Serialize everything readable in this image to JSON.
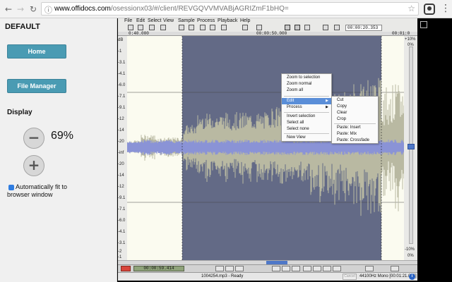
{
  "browser": {
    "url_host": "www.offidocs.com",
    "url_path": "/osession",
    "url_query": "x03/#/client/REVGQVVMVABjAGRIZmF1bHQ="
  },
  "left_panel": {
    "title": "DEFAULT",
    "home_label": "Home",
    "file_manager_label": "File Manager",
    "display_label": "Display",
    "zoom_minus": "−",
    "zoom_plus": "+",
    "zoom_value": "69%",
    "autofit_checked": true,
    "autofit_label": "Automatically fit to browser window"
  },
  "app": {
    "menu": [
      "File",
      "Edit",
      "Select",
      "View",
      "Sample",
      "Process",
      "Playback",
      "Help"
    ],
    "time_display": "00:00:20.353",
    "ruler_labels": [
      "0:40.000",
      "00:00:50.000",
      "00:01:0"
    ],
    "db_labels": [
      "dB",
      "-1",
      "-3.1",
      "-4.1",
      "-6.0",
      "-7.1",
      "-9.1",
      "-12",
      "-14",
      "-20",
      "-inf",
      "-20",
      "-14",
      "-12",
      "-9.1",
      "-7.1",
      "-6.0",
      "-4.1",
      "-3.1",
      "-2",
      "-1"
    ],
    "right_top": "+10%",
    "right_top2": "0%",
    "right_bottom": "-10%",
    "right_bottom2": "0%",
    "position_display": "00:00:59.414",
    "status_text": "1004254.mp3 - Ready",
    "cancel_label": "Cancel",
    "format_text": "44100Hz Mono [00:01:21.006]",
    "info_icon": "info-icon",
    "colors": {
      "selection": "#636a86",
      "wave_unselected": "#b9b9a2",
      "wave_core": "#8a93d6",
      "background": "#fbfbf0",
      "menu_highlight": "#5a8ed8"
    }
  },
  "context_menu": {
    "items": [
      "Zoom to selection",
      "Zoom normal",
      "Zoom all",
      "Edit",
      "Process",
      "Invert selection",
      "Select all",
      "Select none",
      "New View"
    ],
    "highlighted": "Edit"
  },
  "submenu": {
    "items": [
      "Cut",
      "Copy",
      "Clear",
      "Crop",
      "Paste: Insert",
      "Paste: Mix",
      "Paste: Crossfade"
    ]
  }
}
